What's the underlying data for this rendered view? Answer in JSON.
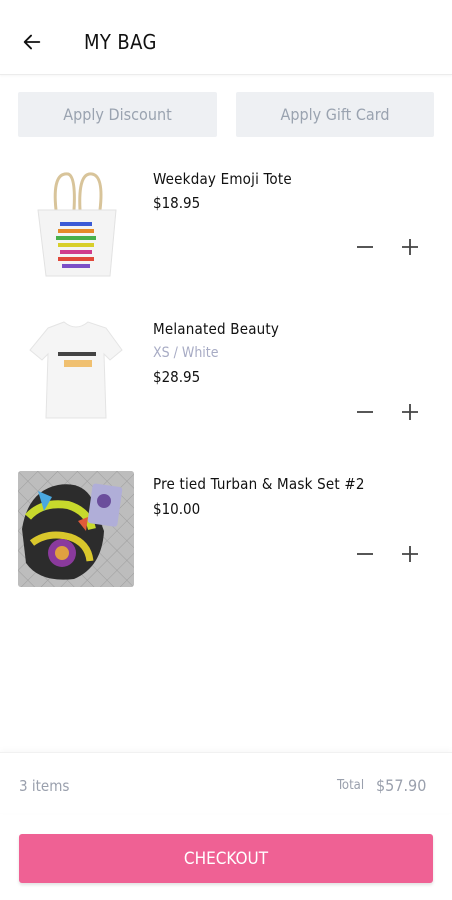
{
  "header": {
    "title": "MY BAG",
    "back_icon": "arrow-left-icon"
  },
  "promo": {
    "discount_label": "Apply Discount",
    "gift_card_label": "Apply Gift Card"
  },
  "cart": {
    "items": [
      {
        "name": "Weekday Emoji Tote",
        "variant": "",
        "price": "$18.95",
        "image": "tote-bag-image"
      },
      {
        "name": "Melanated Beauty",
        "variant": "XS / White",
        "price": "$28.95",
        "image": "tshirt-image"
      },
      {
        "name": "Pre tied Turban & Mask Set #2",
        "variant": "",
        "price": "$10.00",
        "image": "turban-mask-image"
      }
    ],
    "minus_icon": "minus-icon",
    "plus_icon": "plus-icon"
  },
  "summary": {
    "item_count": "3 items",
    "total_label": "Total",
    "total_value": "$57.90"
  },
  "checkout": {
    "label": "CHECKOUT"
  },
  "colors": {
    "accent": "#ef6194",
    "muted_text": "#9aa0ad",
    "variant_text": "#a7abc4",
    "button_bg": "#eef0f3"
  }
}
